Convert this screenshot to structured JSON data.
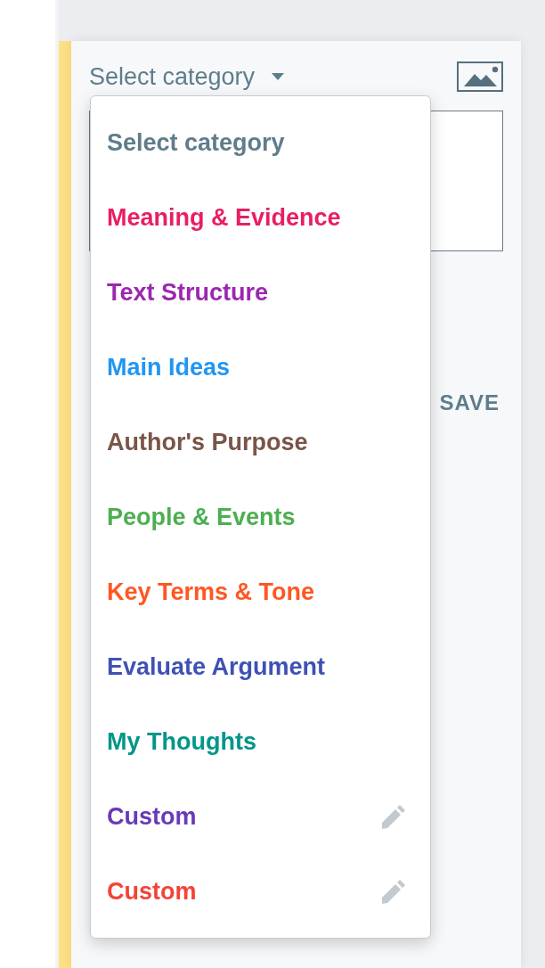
{
  "category_select": {
    "label": "Select category",
    "expanded": true
  },
  "menu": [
    {
      "label": "Select category",
      "color": "#5f7d8b",
      "editable": false
    },
    {
      "label": "Meaning & Evidence",
      "color": "#e91e63",
      "editable": false
    },
    {
      "label": "Text Structure",
      "color": "#9c27b0",
      "editable": false
    },
    {
      "label": "Main Ideas",
      "color": "#2196f3",
      "editable": false
    },
    {
      "label": "Author's Purpose",
      "color": "#795548",
      "editable": false
    },
    {
      "label": "People & Events",
      "color": "#4caf50",
      "editable": false
    },
    {
      "label": "Key Terms & Tone",
      "color": "#ff5722",
      "editable": false
    },
    {
      "label": "Evaluate Argument",
      "color": "#3f51b5",
      "editable": false
    },
    {
      "label": "My Thoughts",
      "color": "#009688",
      "editable": false
    },
    {
      "label": "Custom",
      "color": "#673ab7",
      "editable": true
    },
    {
      "label": "Custom",
      "color": "#f44336",
      "editable": true
    }
  ],
  "save_button": "SAVE"
}
